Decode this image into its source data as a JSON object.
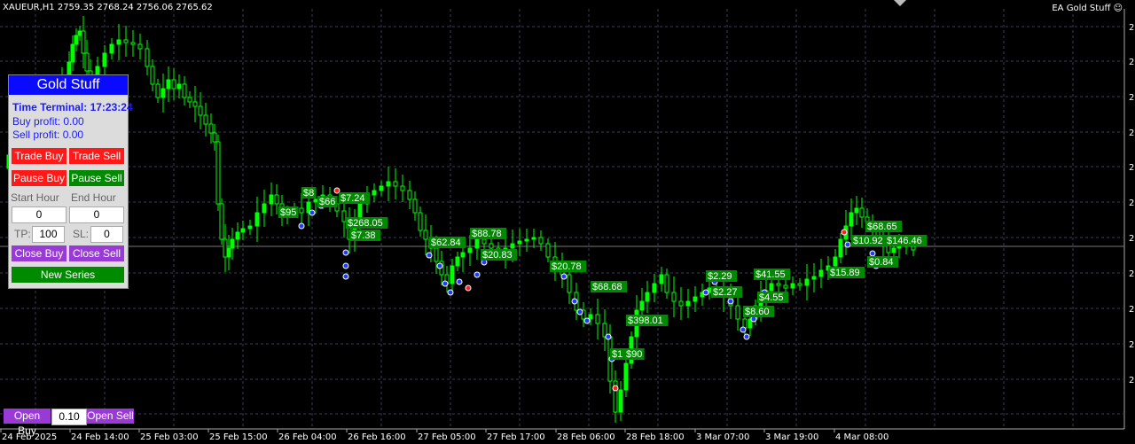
{
  "header": {
    "symbol_info": "XAUEUR,H1  2759.35 2768.24 2756.06 2765.62",
    "ea_label": "EA Gold Stuff",
    "ea_icon": "smiley-icon"
  },
  "panel": {
    "title": "Gold Stuff",
    "time_terminal": "Time Terminal: 17:23:24",
    "buy_profit": "Buy profit: 0.00",
    "sell_profit": "Sell profit: 0.00",
    "trade_buy": "Trade Buy",
    "trade_sell": "Trade Sell",
    "pause_buy": "Pause Buy",
    "pause_sell": "Pause Sell",
    "start_hour_label": "Start Hour",
    "end_hour_label": "End Hour",
    "start_hour": "0",
    "end_hour": "0",
    "tp_label": "TP:",
    "tp": "100",
    "sl_label": "SL:",
    "sl": "0",
    "close_buy": "Close Buy",
    "close_sell": "Close Sell",
    "new_series": "New Series"
  },
  "bottom": {
    "open_buy": "Open Buy",
    "lot": "0.10",
    "open_sell": "Open Sell"
  },
  "xaxis": [
    "24 Feb 2025",
    "24 Feb 14:00",
    "25 Feb 03:00",
    "25 Feb 15:00",
    "26 Feb 04:00",
    "26 Feb 16:00",
    "27 Feb 05:00",
    "27 Feb 17:00",
    "28 Feb 06:00",
    "28 Feb 18:00",
    "3 Mar 07:00",
    "3 Mar 19:00",
    "4 Mar 08:00"
  ],
  "yaxis": [
    "2",
    "2",
    "2",
    "2",
    "2",
    "2",
    "2",
    "2",
    "2",
    "2",
    "2"
  ],
  "profit_labels": [
    "$95",
    "$8",
    "$66",
    "$7.24",
    "$268.05",
    "$7.38",
    "$62.84",
    "$88.78",
    "$20.83",
    "$20.78",
    "$68.68",
    "$398.01",
    "$1",
    "$90",
    "$2.29",
    "$41.55",
    "$2.27",
    "$4.55",
    "$8.60",
    "$68.65",
    "$10.92",
    "$146.46",
    "$0.84",
    "$15.89"
  ],
  "colors": {
    "candle": "#00ff00",
    "grid": "#3c3c50",
    "label_bg": "#008a00",
    "panel_title": "#0a0aff"
  }
}
